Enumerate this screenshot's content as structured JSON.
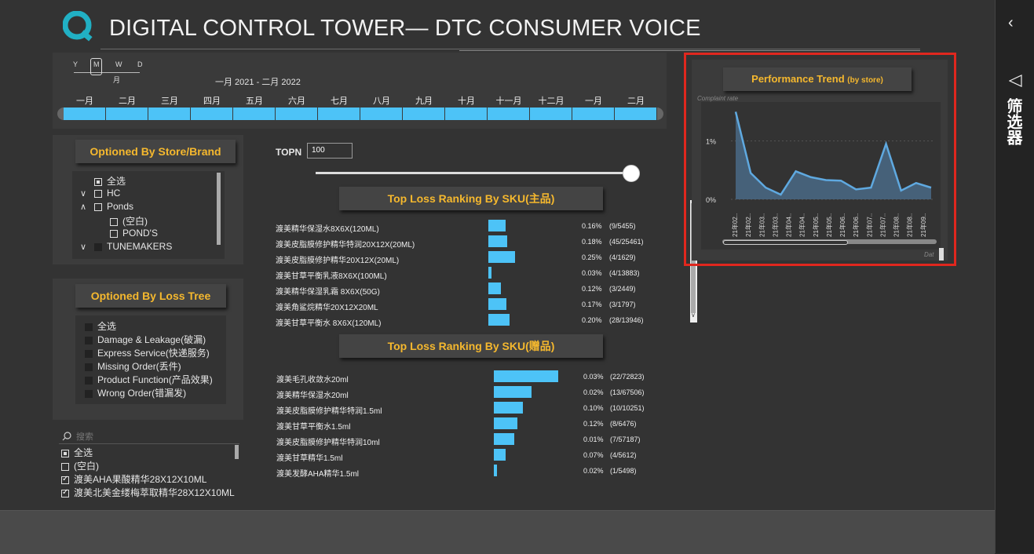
{
  "header": {
    "title": "DIGITAL CONTROL TOWER— DTC CONSUMER VOICE"
  },
  "timeline": {
    "granularity": [
      "Y",
      "M",
      "W",
      "D"
    ],
    "selected_granularity_label": "月",
    "range_label": "一月 2021 - 二月 2022",
    "months": [
      "一月",
      "二月",
      "三月",
      "四月",
      "五月",
      "六月",
      "七月",
      "八月",
      "九月",
      "十月",
      "十一月",
      "十二月",
      "一月",
      "二月"
    ]
  },
  "store_filter": {
    "title": "Optioned  By Store/Brand",
    "items": [
      {
        "label": "全选",
        "state": "partial",
        "indent": 0,
        "expander": ""
      },
      {
        "label": "HC",
        "state": "empty",
        "indent": 0,
        "expander": "∨"
      },
      {
        "label": "Ponds",
        "state": "empty",
        "indent": 0,
        "expander": "∧"
      },
      {
        "label": "(空白)",
        "state": "empty",
        "indent": 1,
        "expander": ""
      },
      {
        "label": "POND'S",
        "state": "empty",
        "indent": 1,
        "expander": ""
      },
      {
        "label": "TUNEMAKERS",
        "state": "dark",
        "indent": 0,
        "expander": "∨"
      }
    ]
  },
  "loss_tree_filter": {
    "title": "Optioned  By Loss Tree",
    "items": [
      "全选",
      "Damage & Leakage(破漏)",
      "Express Service(快递服务)",
      "Missing Order(丢件)",
      "Product Function(产品效果)",
      "Wrong Order(错漏发)"
    ]
  },
  "sku_list": {
    "search_placeholder": "搜索",
    "items": [
      {
        "label": "全选",
        "state": "partial"
      },
      {
        "label": "(空白)",
        "state": "empty"
      },
      {
        "label": "渡美AHA果酸精华28X12X10ML",
        "state": "checked"
      },
      {
        "label": "渡美北美金缕梅萃取精华28X12X10ML",
        "state": "checked"
      }
    ]
  },
  "topn": {
    "label": "TOPN",
    "value": "100",
    "slider_level": 1.0
  },
  "main_ranking": {
    "title": "Top Loss Ranking By SKU(主品)",
    "rows": [
      {
        "label": "渡美精华保湿水8X6X(120ML)",
        "value": 0.16,
        "pct": "0.16%",
        "frac": "(9/5455)"
      },
      {
        "label": "渡美皮脂膜修护精华特润20X12X(20ML)",
        "value": 0.18,
        "pct": "0.18%",
        "frac": "(45/25461)"
      },
      {
        "label": "渡美皮脂膜修护精华20X12X(20ML)",
        "value": 0.25,
        "pct": "0.25%",
        "frac": "(4/1629)"
      },
      {
        "label": "渡美甘草平衡乳液8X6X(100ML)",
        "value": 0.03,
        "pct": "0.03%",
        "frac": "(4/13883)"
      },
      {
        "label": "渡美精华保湿乳霜 8X6X(50G)",
        "value": 0.12,
        "pct": "0.12%",
        "frac": "(3/2449)"
      },
      {
        "label": "渡美角鲨烷精华20X12X20ML",
        "value": 0.17,
        "pct": "0.17%",
        "frac": "(3/1797)"
      },
      {
        "label": "渡美甘草平衡水 8X6X(120ML)",
        "value": 0.2,
        "pct": "0.20%",
        "frac": "(28/13946)"
      }
    ]
  },
  "gift_ranking": {
    "title": "Top Loss Ranking By SKU(赠品)",
    "rows": [
      {
        "label": "渡美毛孔收敛水20ml",
        "value": 22,
        "pct": "0.03%",
        "frac": "(22/72823)"
      },
      {
        "label": "渡美精华保湿水20ml",
        "value": 13,
        "pct": "0.02%",
        "frac": "(13/67506)"
      },
      {
        "label": "渡美皮脂膜修护精华特润1.5ml",
        "value": 10,
        "pct": "0.10%",
        "frac": "(10/10251)"
      },
      {
        "label": "渡美甘草平衡水1.5ml",
        "value": 8,
        "pct": "0.12%",
        "frac": "(8/6476)"
      },
      {
        "label": "渡美皮脂膜修护精华特润10ml",
        "value": 7,
        "pct": "0.01%",
        "frac": "(7/57187)"
      },
      {
        "label": "渡美甘草精华1.5ml",
        "value": 4,
        "pct": "0.07%",
        "frac": "(4/5612)"
      },
      {
        "label": "渡美发酵AHA精华1.5ml",
        "value": 1,
        "pct": "0.02%",
        "frac": "(1/5498)"
      }
    ]
  },
  "trend": {
    "title": "Performance Trend",
    "title_suffix": "(by store)",
    "y_axis_label": "Complaint rate",
    "x_axis_label": "Dat",
    "y_ticks": [
      "1%",
      "0%"
    ]
  },
  "chart_data": {
    "type": "area",
    "title": "Performance Trend (by store)",
    "ylabel": "Complaint rate",
    "xlabel": "Dat",
    "ylim": [
      0,
      1.6
    ],
    "x": [
      "21年02..",
      "21年02..",
      "21年03..",
      "21年03..",
      "21年04..",
      "21年04..",
      "21年05..",
      "21年05..",
      "21年06..",
      "21年06..",
      "21年07..",
      "21年07..",
      "21年08..",
      "21年08..",
      "21年09.."
    ],
    "values": [
      1.5,
      0.45,
      0.2,
      0.08,
      0.48,
      0.38,
      0.33,
      0.32,
      0.17,
      0.2,
      0.95,
      0.15,
      0.28,
      0.2
    ]
  },
  "sidebar": {
    "collapse_icon": "chevron-left-icon",
    "filter_label": "筛选器"
  },
  "colors": {
    "accent": "#f5b82e",
    "bar": "#4dc3f7",
    "highlight": "#e0271e",
    "background": "#333333"
  }
}
